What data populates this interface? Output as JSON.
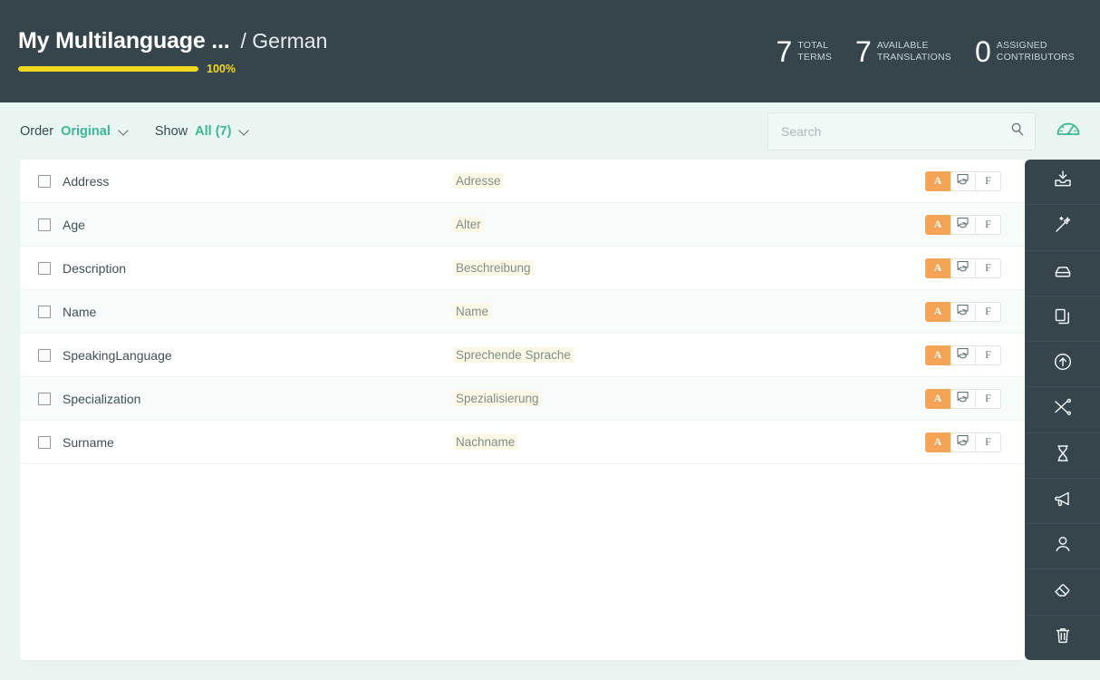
{
  "header": {
    "project_name": "My Multilanguage ...",
    "language_separator": "/ German",
    "progress_percent": "100%",
    "progress_value": 100,
    "accent_progress_color": "#f2d81e",
    "background_color": "#36444c",
    "stats": [
      {
        "number": "7",
        "line1": "TOTAL",
        "line2": "TERMS"
      },
      {
        "number": "7",
        "line1": "AVAILABLE",
        "line2": "TRANSLATIONS"
      },
      {
        "number": "0",
        "line1": "ASSIGNED",
        "line2": "CONTRIBUTORS"
      }
    ]
  },
  "toolbar": {
    "order_label": "Order",
    "order_value": "Original",
    "show_label": "Show",
    "show_value": "All (7)",
    "search_placeholder": "Search",
    "search_value": "",
    "accent_color": "#3ab795",
    "gauge_icon": "speedometer-icon"
  },
  "table": {
    "rows": [
      {
        "term": "Address",
        "translation": "Adresse",
        "checked": false
      },
      {
        "term": "Age",
        "translation": "Alter",
        "checked": false
      },
      {
        "term": "Description",
        "translation": "Beschreibung",
        "checked": false
      },
      {
        "term": "Name",
        "translation": "Name",
        "checked": false
      },
      {
        "term": "SpeakingLanguage",
        "translation": "Sprechende Sprache",
        "checked": false
      },
      {
        "term": "Specialization",
        "translation": "Spezialisierung",
        "checked": false
      },
      {
        "term": "Surname",
        "translation": "Nachname",
        "checked": false
      }
    ],
    "actions": {
      "approve_label": "A",
      "comment_label": "comment-icon",
      "flag_label": "F",
      "approve_color": "#f5a457"
    }
  },
  "sidebar": {
    "background_color": "#36444c",
    "items": [
      {
        "icon": "import-icon",
        "name": "import"
      },
      {
        "icon": "magic-wand-icon",
        "name": "auto-translate"
      },
      {
        "icon": "archive-icon",
        "name": "archive"
      },
      {
        "icon": "copy-icon",
        "name": "duplicate"
      },
      {
        "icon": "upload-circle-icon",
        "name": "publish"
      },
      {
        "icon": "shuffle-icon",
        "name": "shuffle"
      },
      {
        "icon": "hourglass-icon",
        "name": "history"
      },
      {
        "icon": "megaphone-icon",
        "name": "announce"
      },
      {
        "icon": "user-icon",
        "name": "assign-user"
      },
      {
        "icon": "eraser-icon",
        "name": "clear"
      },
      {
        "icon": "trash-icon",
        "name": "delete"
      }
    ]
  }
}
